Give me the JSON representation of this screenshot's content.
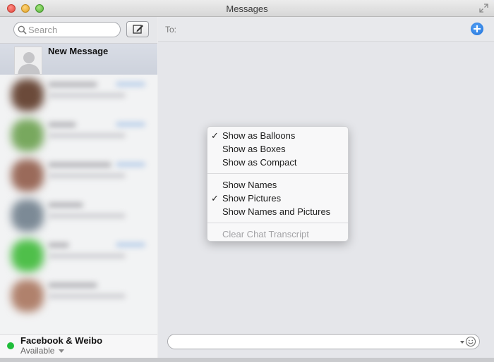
{
  "window": {
    "title": "Messages"
  },
  "sidebar": {
    "search_placeholder": "Search",
    "new_message_label": "New Message",
    "account": {
      "name": "Facebook & Weibo",
      "status": "Available",
      "status_color": "#1fbd3b"
    },
    "conversation_thumb_colors": [
      "#6b4a3a",
      "#78a85e",
      "#9a6a5a",
      "#7c8a96",
      "#4fbf4a",
      "#b0816c"
    ]
  },
  "main": {
    "to_label": "To:",
    "accent_color": "#1d6fd8"
  },
  "context_menu": {
    "groups": [
      [
        {
          "label": "Show as Balloons",
          "checked": true,
          "enabled": true
        },
        {
          "label": "Show as Boxes",
          "checked": false,
          "enabled": true
        },
        {
          "label": "Show as Compact",
          "checked": false,
          "enabled": true
        }
      ],
      [
        {
          "label": "Show Names",
          "checked": false,
          "enabled": true
        },
        {
          "label": "Show Pictures",
          "checked": true,
          "enabled": true
        },
        {
          "label": "Show Names and Pictures",
          "checked": false,
          "enabled": true
        }
      ],
      [
        {
          "label": "Clear Chat Transcript",
          "checked": false,
          "enabled": false
        }
      ]
    ]
  }
}
